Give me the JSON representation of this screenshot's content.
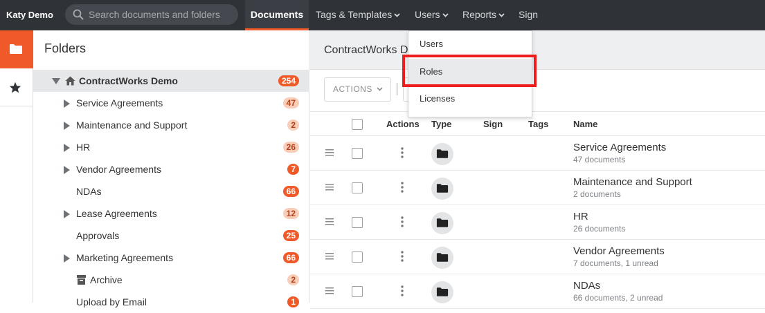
{
  "app": {
    "user_name": "Katy Demo",
    "accent_color": "#f05a28"
  },
  "search": {
    "placeholder": "Search documents and folders",
    "icon": "search-icon"
  },
  "nav": {
    "documents": "Documents",
    "tags_templates": "Tags & Templates",
    "users": "Users",
    "reports": "Reports",
    "sign": "Sign"
  },
  "users_menu": {
    "items": [
      {
        "label": "Users"
      },
      {
        "label": "Roles"
      },
      {
        "label": "Licenses"
      }
    ],
    "highlighted": "Roles"
  },
  "rail": {
    "folders_icon": "folder-icon",
    "favorites_icon": "star-icon"
  },
  "folders_panel": {
    "title": "Folders",
    "root": {
      "label": "ContractWorks Demo",
      "count": "254"
    },
    "items": [
      {
        "label": "Service Agreements",
        "count": "47"
      },
      {
        "label": "Maintenance and Support",
        "count": "2"
      },
      {
        "label": "HR",
        "count": "26"
      },
      {
        "label": "Vendor Agreements",
        "count": "7"
      },
      {
        "label": "NDAs",
        "count": "66"
      },
      {
        "label": "Lease Agreements",
        "count": "12"
      },
      {
        "label": "Approvals",
        "count": "25"
      },
      {
        "label": "Marketing Agreements",
        "count": "66"
      },
      {
        "label": "Archive",
        "count": "2"
      },
      {
        "label": "Upload by Email",
        "count": "1"
      }
    ]
  },
  "main": {
    "breadcrumb": "ContractWorks De",
    "actions_label": "ACTIONS",
    "columns": {
      "actions": "Actions",
      "type": "Type",
      "sign": "Sign",
      "tags": "Tags",
      "name": "Name"
    },
    "rows": [
      {
        "name": "Service Agreements",
        "detail": "47 documents"
      },
      {
        "name": "Maintenance and Support",
        "detail": "2 documents"
      },
      {
        "name": "HR",
        "detail": "26 documents"
      },
      {
        "name": "Vendor Agreements",
        "detail": "7 documents, 1 unread"
      },
      {
        "name": "NDAs",
        "detail": "66 documents, 2 unread"
      }
    ]
  }
}
